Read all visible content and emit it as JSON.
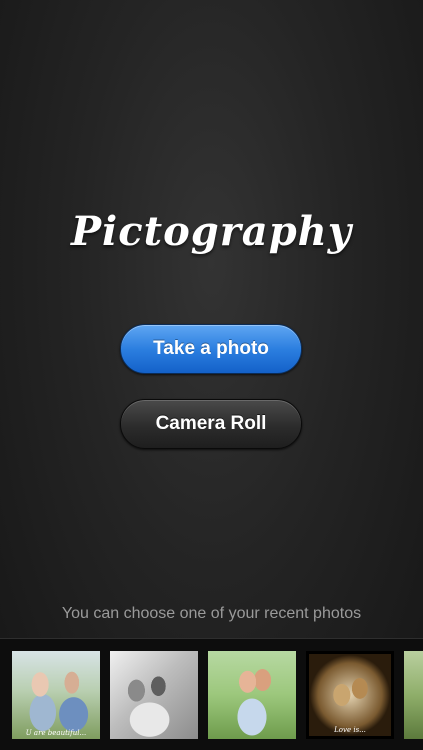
{
  "app": {
    "logo_text": "Pictography"
  },
  "actions": {
    "take_photo_label": "Take a photo",
    "camera_roll_label": "Camera Roll"
  },
  "recent": {
    "caption": "You can choose one of your recent photos",
    "photos": [
      {
        "caption": "U are beautiful..."
      },
      {
        "caption": ""
      },
      {
        "caption": ""
      },
      {
        "caption": "Love is..."
      },
      {
        "caption": ""
      }
    ]
  },
  "colors": {
    "background": "#242424",
    "primary_button": "#2c7fe0",
    "secondary_button": "#2c2c2c",
    "caption_text": "#9a9a9a"
  }
}
